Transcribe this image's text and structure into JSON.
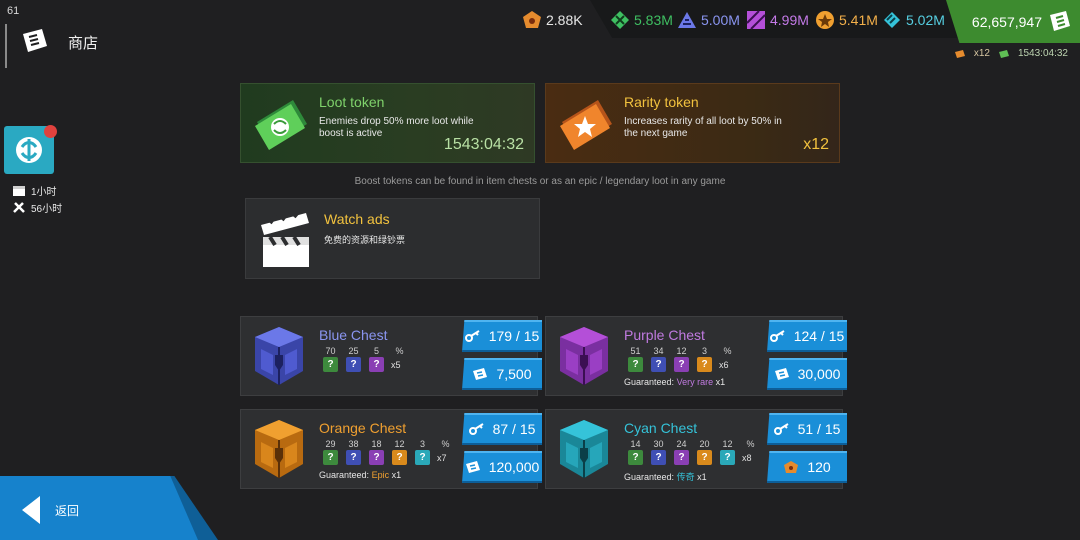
{
  "fps": "61",
  "header": {
    "title": "商店",
    "icon": "ticket-icon"
  },
  "resources": [
    {
      "icon": "shield-token-icon",
      "value": "2.88K",
      "color": "#e58b2e"
    },
    {
      "icon": "green-crystal-icon",
      "value": "5.83M",
      "color": "#3fbf62"
    },
    {
      "icon": "blue-triangle-icon",
      "value": "5.00M",
      "color": "#6b78e8"
    },
    {
      "icon": "purple-stripes-icon",
      "value": "4.99M",
      "color": "#b44fd8"
    },
    {
      "icon": "orange-star-icon",
      "value": "5.41M",
      "color": "#f0a030"
    },
    {
      "icon": "cyan-stripes-icon",
      "value": "5.02M",
      "color": "#35c3d9"
    }
  ],
  "money": {
    "value": "62,657,947",
    "icon": "cash-icon"
  },
  "boost_summary": {
    "rarity_count": "x12",
    "loot_timer": "1543:04:32"
  },
  "side": {
    "timers": [
      {
        "icon": "chest-icon",
        "label": "1小时"
      },
      {
        "icon": "tools-icon",
        "label": "56小时"
      }
    ]
  },
  "tokens": {
    "loot": {
      "title": "Loot token",
      "desc": "Enemies drop 50% more loot while boost is active",
      "value": "1543:04:32",
      "title_color": "#7fd26b",
      "value_color": "#b8e0a4"
    },
    "rarity": {
      "title": "Rarity token",
      "desc": "Increases rarity of all loot by 50% in the next game",
      "value": "x12",
      "title_color": "#f2c23e",
      "value_color": "#f2c23e"
    }
  },
  "boost_hint": "Boost tokens can be found in item chests or as an epic / legendary loot in any game",
  "ads": {
    "title": "Watch ads",
    "desc": "免费的资源和绿钞票"
  },
  "chests": [
    {
      "name": "Blue Chest",
      "color": "#5565d8",
      "pcts": [
        "70",
        "25",
        "5",
        "%"
      ],
      "q": [
        "green",
        "blue",
        "purple"
      ],
      "mult": "x5",
      "guaranteed": "",
      "g_label": "",
      "g_color": "",
      "keys": "179 / 15",
      "price": "7,500",
      "price_icon": "cash-icon"
    },
    {
      "name": "Purple Chest",
      "color": "#b05ad8",
      "pcts": [
        "51",
        "34",
        "12",
        "3",
        "%"
      ],
      "q": [
        "green",
        "blue",
        "purple",
        "orange"
      ],
      "mult": "x6",
      "guaranteed": "Guaranteed:",
      "g_label": "Very rare",
      "g_suffix": "x1",
      "g_color": "#c07ae0",
      "keys": "124 / 15",
      "price": "30,000",
      "price_icon": "cash-icon"
    },
    {
      "name": "Orange Chest",
      "color": "#f0a030",
      "pcts": [
        "29",
        "38",
        "18",
        "12",
        "3",
        "%"
      ],
      "q": [
        "green",
        "blue",
        "purple",
        "orange",
        "cyan"
      ],
      "mult": "x7",
      "guaranteed": "Guaranteed:",
      "g_label": "Epic",
      "g_suffix": "x1",
      "g_color": "#f0a030",
      "keys": "87 / 15",
      "price": "120,000",
      "price_icon": "cash-icon"
    },
    {
      "name": "Cyan Chest",
      "color": "#35c3d9",
      "pcts": [
        "14",
        "30",
        "24",
        "20",
        "12",
        "%"
      ],
      "q": [
        "green",
        "blue",
        "purple",
        "orange",
        "cyan"
      ],
      "mult": "x8",
      "guaranteed": "Guaranteed:",
      "g_label": "传奇",
      "g_suffix": "x1",
      "g_color": "#35c3d9",
      "keys": "51 / 15",
      "price": "120",
      "price_icon": "shield-token-icon"
    }
  ],
  "back": {
    "label": "返回"
  }
}
